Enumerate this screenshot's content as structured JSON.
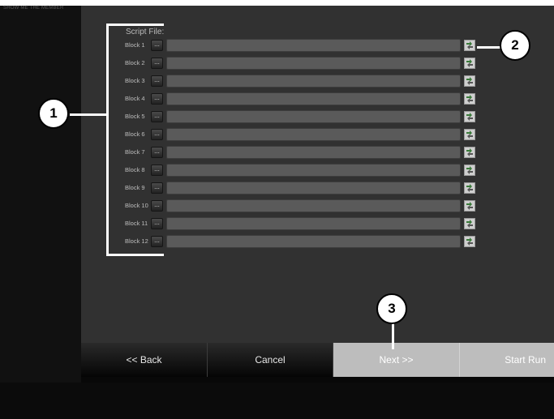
{
  "sidebar": {
    "caption": "SHOW ME THE MEMBER"
  },
  "script_file_label": "Script File:",
  "blocks": [
    {
      "label": "Block 1",
      "browse": "...",
      "path": ""
    },
    {
      "label": "Block 2",
      "browse": "...",
      "path": ""
    },
    {
      "label": "Block 3",
      "browse": "...",
      "path": ""
    },
    {
      "label": "Block 4",
      "browse": "...",
      "path": ""
    },
    {
      "label": "Block 5",
      "browse": "...",
      "path": ""
    },
    {
      "label": "Block 6",
      "browse": "...",
      "path": ""
    },
    {
      "label": "Block 7",
      "browse": "...",
      "path": ""
    },
    {
      "label": "Block 8",
      "browse": "...",
      "path": ""
    },
    {
      "label": "Block 9",
      "browse": "...",
      "path": ""
    },
    {
      "label": "Block 10",
      "browse": "...",
      "path": ""
    },
    {
      "label": "Block 11",
      "browse": "...",
      "path": ""
    },
    {
      "label": "Block 12",
      "browse": "...",
      "path": ""
    }
  ],
  "row_icon": "refresh-icon",
  "buttons": {
    "back": "<< Back",
    "cancel": "Cancel",
    "next": "Next >>",
    "start_run": "Start Run"
  },
  "callouts": {
    "one": "1",
    "two": "2",
    "three": "3"
  },
  "colors": {
    "panel": "#313131",
    "field": "#5a5a5a",
    "disabled_button": "#bdbdbd"
  }
}
